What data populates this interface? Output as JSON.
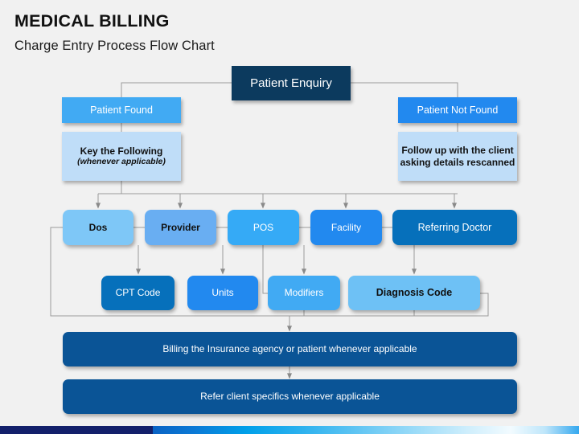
{
  "header": {
    "title": "MEDICAL BILLING",
    "subtitle": "Charge Entry Process Flow Chart"
  },
  "flow": {
    "root": {
      "label": "Patient Enquiry",
      "color": "#0c3a5e"
    },
    "branches": {
      "found": {
        "header": {
          "label": "Patient Found",
          "color": "#41aaf3"
        },
        "body": {
          "line1": "Key the Following",
          "line2": "(whenever applicable)",
          "color": "#bfddf8"
        }
      },
      "not_found": {
        "header": {
          "label": "Patient Not Found",
          "color": "#2289ef"
        },
        "body": {
          "label": "Follow up with the client asking details rescanned",
          "color": "#bfddf8"
        }
      }
    },
    "fields_row": [
      {
        "label": "Dos",
        "color": "#7ec7f7"
      },
      {
        "label": "Provider",
        "color": "#69aef2"
      },
      {
        "label": "POS",
        "color": "#35aaf6"
      },
      {
        "label": "Facility",
        "color": "#2289ef"
      },
      {
        "label": "Referring Doctor",
        "color": "#0670bb"
      }
    ],
    "codes_row": [
      {
        "label": "CPT Code",
        "color": "#0670bb"
      },
      {
        "label": "Units",
        "color": "#2289ef"
      },
      {
        "label": "Modifiers",
        "color": "#41aaf3"
      },
      {
        "label": "Diagnosis Code",
        "color": "#6ec1f5"
      }
    ],
    "outcome_bars": [
      {
        "label": "Billing the Insurance agency or patient whenever applicable",
        "color": "#0a5496"
      },
      {
        "label": "Refer client specifics whenever applicable",
        "color": "#0a5496"
      }
    ]
  },
  "footer_strip": {
    "navy": "#13206b",
    "gradient_start": "#0a63c4",
    "gradient_end": "#35a8ef"
  }
}
